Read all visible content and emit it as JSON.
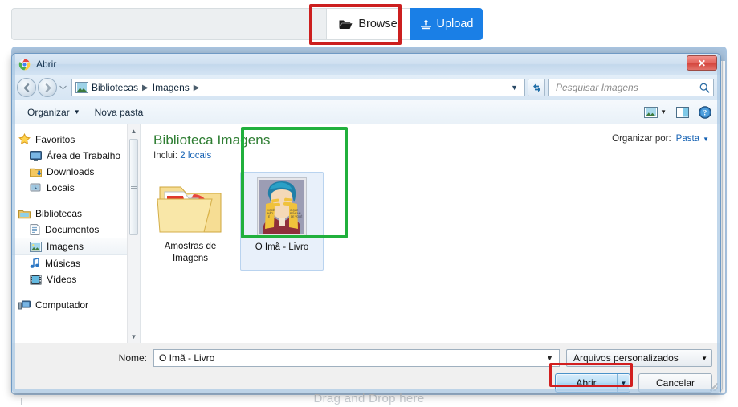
{
  "page": {
    "file_input_value": "",
    "browse_label": "Browse",
    "browse_icon": "open-folder-icon",
    "upload_label": "Upload",
    "upload_icon": "upload-icon",
    "dropzone_text": "Drag and Drop here",
    "accent_blue": "#1a7fe6",
    "annotation_red": "#cc1f1f",
    "annotation_green": "#20b03c"
  },
  "dialog": {
    "title": "Abrir",
    "app_icon": "chrome-icon",
    "close_label": "✕",
    "nav": {
      "back_icon": "back-arrow-icon",
      "forward_icon": "forward-arrow-icon",
      "history_icon": "chevron-down-icon",
      "address_icon": "pictures-library-icon",
      "breadcrumbs": [
        "Bibliotecas",
        "Imagens"
      ],
      "breadcrumb_separator": "▶",
      "address_dropdown_icon": "chevron-down-icon",
      "refresh_icon": "refresh-icon",
      "search_placeholder": "Pesquisar Imagens",
      "search_value": "",
      "search_icon": "search-icon"
    },
    "toolbar": {
      "organize_label": "Organizar",
      "organize_caret": "▼",
      "new_folder_label": "Nova pasta",
      "view_icon": "view-layout-icon",
      "view_caret": "▼",
      "preview_pane_icon": "preview-pane-icon",
      "help_icon": "help-icon"
    },
    "sidebar": {
      "groups": [
        {
          "name": "Favoritos",
          "icon": "star-icon",
          "items": [
            {
              "label": "Área de Trabalho",
              "icon": "desktop-icon",
              "selected": false
            },
            {
              "label": "Downloads",
              "icon": "downloads-folder-icon",
              "selected": false
            },
            {
              "label": "Locais",
              "icon": "recent-places-icon",
              "selected": false
            }
          ]
        },
        {
          "name": "Bibliotecas",
          "icon": "libraries-icon",
          "items": [
            {
              "label": "Documentos",
              "icon": "documents-library-icon",
              "selected": false
            },
            {
              "label": "Imagens",
              "icon": "pictures-library-icon",
              "selected": true
            },
            {
              "label": "Músicas",
              "icon": "music-library-icon",
              "selected": false
            },
            {
              "label": "Vídeos",
              "icon": "videos-library-icon",
              "selected": false
            }
          ]
        },
        {
          "name": "Computador",
          "icon": "computer-icon",
          "items": []
        }
      ],
      "scroll_up_icon": "scroll-up-arrow-icon",
      "scroll_down_icon": "scroll-down-arrow-icon"
    },
    "content": {
      "library_title": "Biblioteca Imagens",
      "library_subtitle_prefix": "Inclui:",
      "library_subtitle_link": "2 locais",
      "arrange_label": "Organizar por:",
      "arrange_value": "Pasta",
      "arrange_caret": "▼",
      "items": [
        {
          "label": "Amostras de Imagens",
          "type": "folder",
          "selected": false
        },
        {
          "label": "O Imã - Livro",
          "type": "image",
          "selected": true
        }
      ]
    },
    "footer": {
      "name_label": "Nome:",
      "name_value": "O Imã - Livro",
      "name_caret": "▼",
      "filetype_value": "Arquivos personalizados",
      "filetype_caret": "▼",
      "open_label": "Abrir",
      "open_split_caret": "▼",
      "cancel_label": "Cancelar"
    }
  }
}
